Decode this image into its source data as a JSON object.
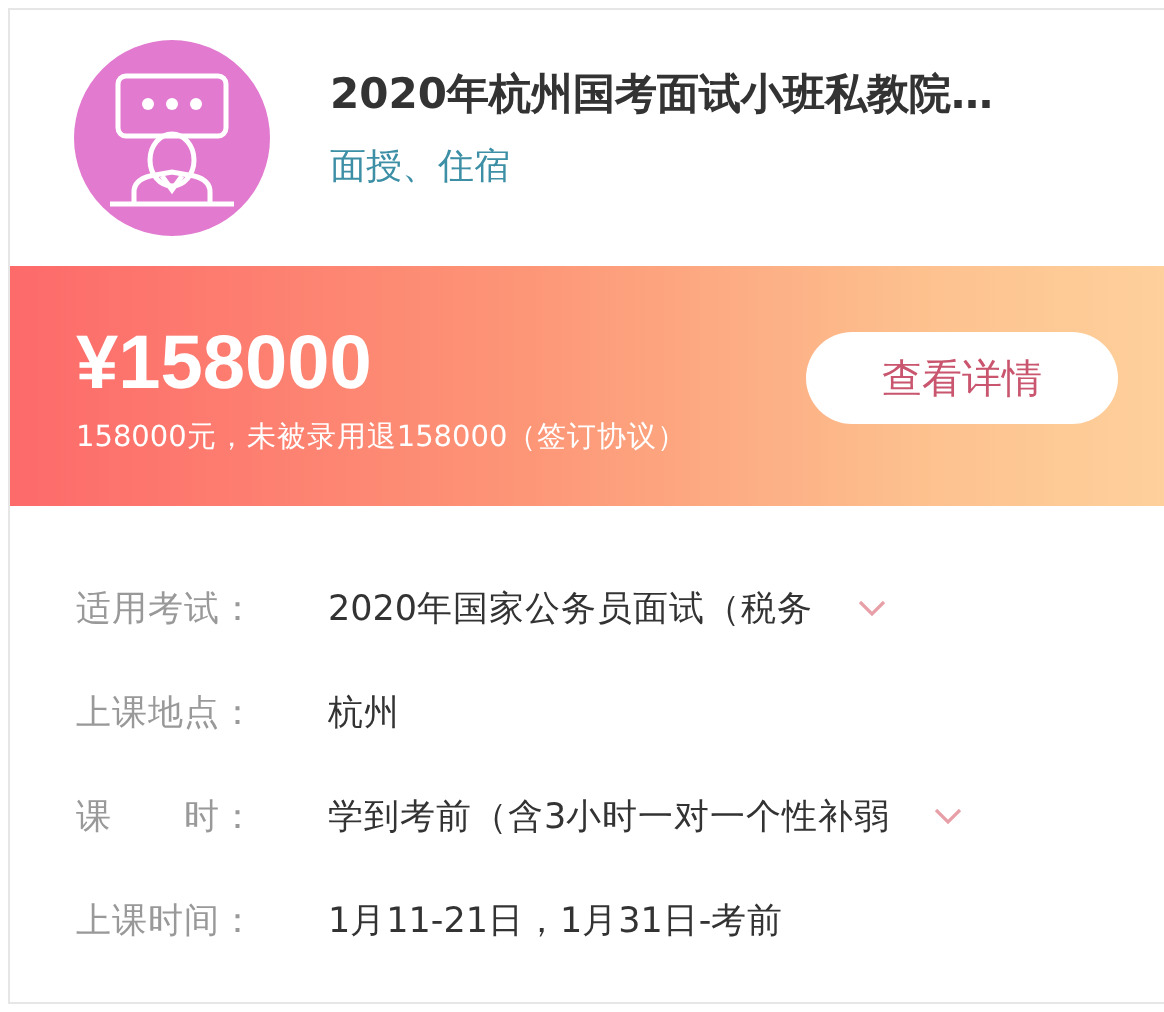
{
  "course": {
    "title": "2020年杭州国考面试小班私教院…",
    "tags": "面授、住宿"
  },
  "price_banner": {
    "price": "¥158000",
    "note": "158000元，未被录用退158000（签订协议）",
    "details_button": "查看详情"
  },
  "info_rows": [
    {
      "label": "适用考试：",
      "value": "2020年国家公务员面试（税务",
      "expandable": true
    },
    {
      "label": "上课地点：",
      "value": "杭州",
      "expandable": false
    },
    {
      "label": "课　　时：",
      "value": "学到考前（含3小时一对一个性补弱",
      "expandable": true
    },
    {
      "label": "上课时间：",
      "value": "1月11-21日，1月31日-考前",
      "expandable": false
    }
  ]
}
